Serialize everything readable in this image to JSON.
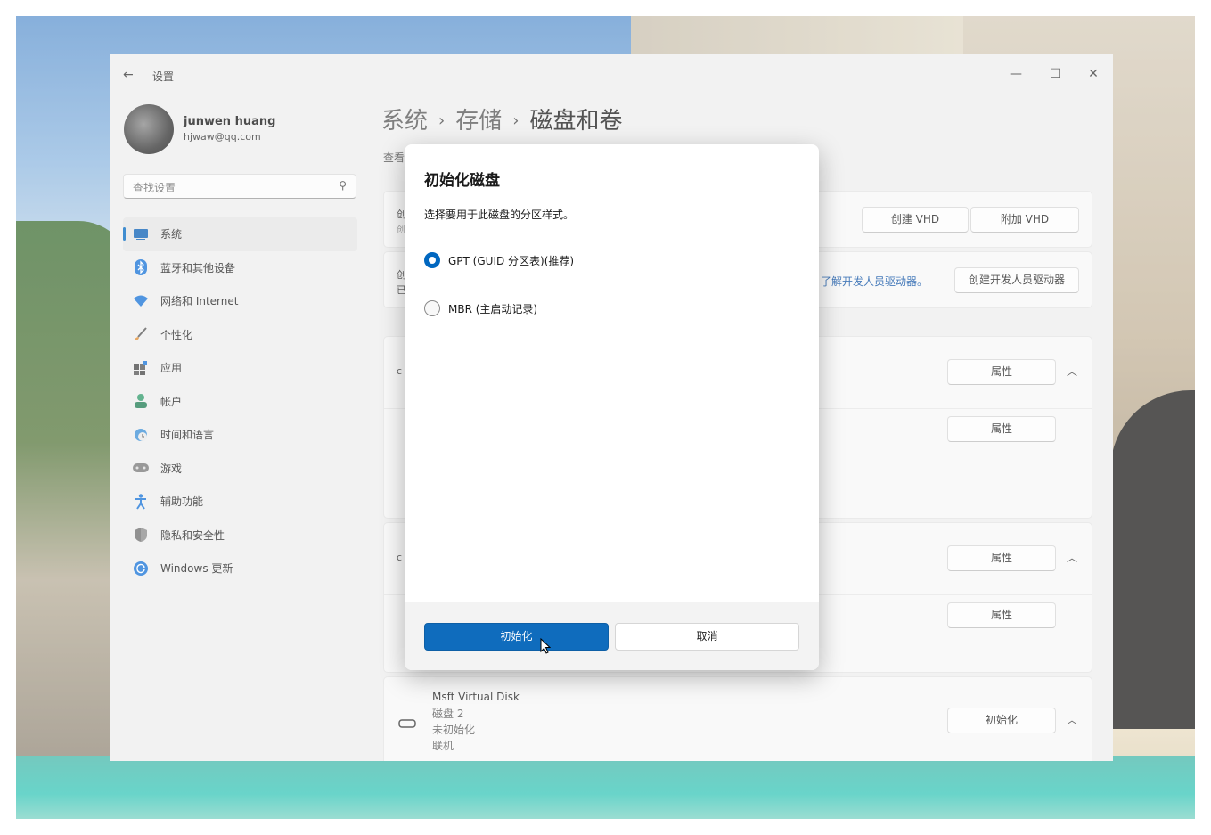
{
  "window": {
    "app_title": "设置",
    "controls": {
      "minimize": "—",
      "maximize": "☐",
      "close": "✕"
    }
  },
  "user": {
    "name": "junwen huang",
    "email": "hjwaw@qq.com"
  },
  "search": {
    "placeholder": "查找设置"
  },
  "sidebar": {
    "items": [
      {
        "label": "系统",
        "icon": "system-icon"
      },
      {
        "label": "蓝牙和其他设备",
        "icon": "bluetooth-icon"
      },
      {
        "label": "网络和 Internet",
        "icon": "wifi-icon"
      },
      {
        "label": "个性化",
        "icon": "brush-icon"
      },
      {
        "label": "应用",
        "icon": "apps-icon"
      },
      {
        "label": "帐户",
        "icon": "person-icon"
      },
      {
        "label": "时间和语言",
        "icon": "globe-clock-icon"
      },
      {
        "label": "游戏",
        "icon": "gamepad-icon"
      },
      {
        "label": "辅助功能",
        "icon": "accessibility-icon"
      },
      {
        "label": "隐私和安全性",
        "icon": "shield-icon"
      },
      {
        "label": "Windows 更新",
        "icon": "update-icon"
      }
    ]
  },
  "breadcrumb": {
    "level1": "系统",
    "level2": "存储",
    "current": "磁盘和卷",
    "separator": "›"
  },
  "main": {
    "description_fragment": "查看",
    "card1": {
      "create_vhd": "创建 VHD",
      "attach_vhd": "附加 VHD",
      "cut1": "创",
      "cut2": "创"
    },
    "card2": {
      "link": "了解开发人员驱动器。",
      "button": "创建开发人员驱动器",
      "cut1": "创",
      "cut2": "已"
    },
    "disk_section1": {
      "properties1": "属性",
      "properties2": "属性",
      "cut": "c"
    },
    "disk_section2": {
      "properties1": "属性",
      "properties2": "属性",
      "cut": "c"
    },
    "disk_section3": {
      "name": "Msft Virtual Disk",
      "disk": "磁盘 2",
      "status": "未初始化",
      "online": "联机",
      "button": "初始化"
    }
  },
  "dialog": {
    "title": "初始化磁盘",
    "instruction": "选择要用于此磁盘的分区样式。",
    "options": [
      {
        "label": "GPT (GUID 分区表)(推荐)",
        "selected": true
      },
      {
        "label": "MBR (主启动记录)",
        "selected": false
      }
    ],
    "primary_button": "初始化",
    "secondary_button": "取消"
  },
  "colors": {
    "accent": "#0067c0",
    "primary_button": "#0f6cbd"
  }
}
